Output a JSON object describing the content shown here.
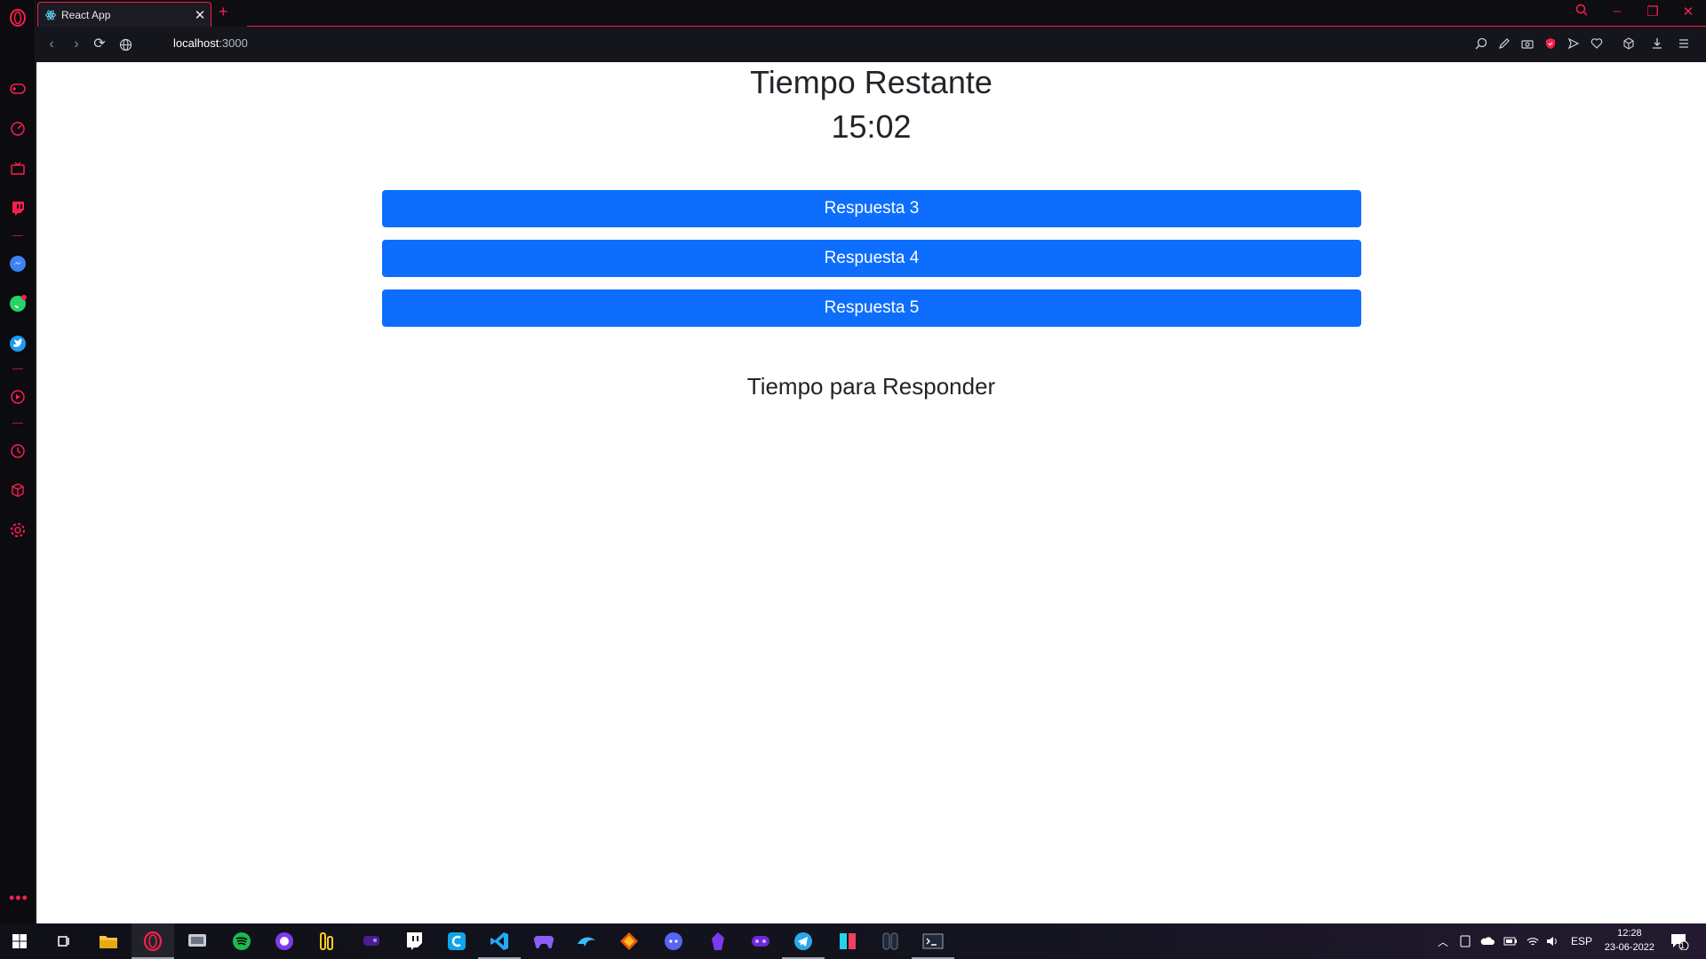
{
  "browser": {
    "tab_title": "React App",
    "tab_close": "✕",
    "new_tab": "+",
    "url_host": "localhost",
    "url_port": ":3000",
    "accent": "#fa1e4e"
  },
  "page": {
    "title": "Tiempo Restante",
    "timer": "15:02",
    "answers": [
      "Respuesta 3",
      "Respuesta 4",
      "Respuesta 5"
    ],
    "subtitle": "Tiempo para Responder",
    "button_color": "#0d6efd"
  },
  "taskbar": {
    "language": "ESP",
    "time": "12:28",
    "date": "23-06-2022",
    "notification_count": "1"
  }
}
